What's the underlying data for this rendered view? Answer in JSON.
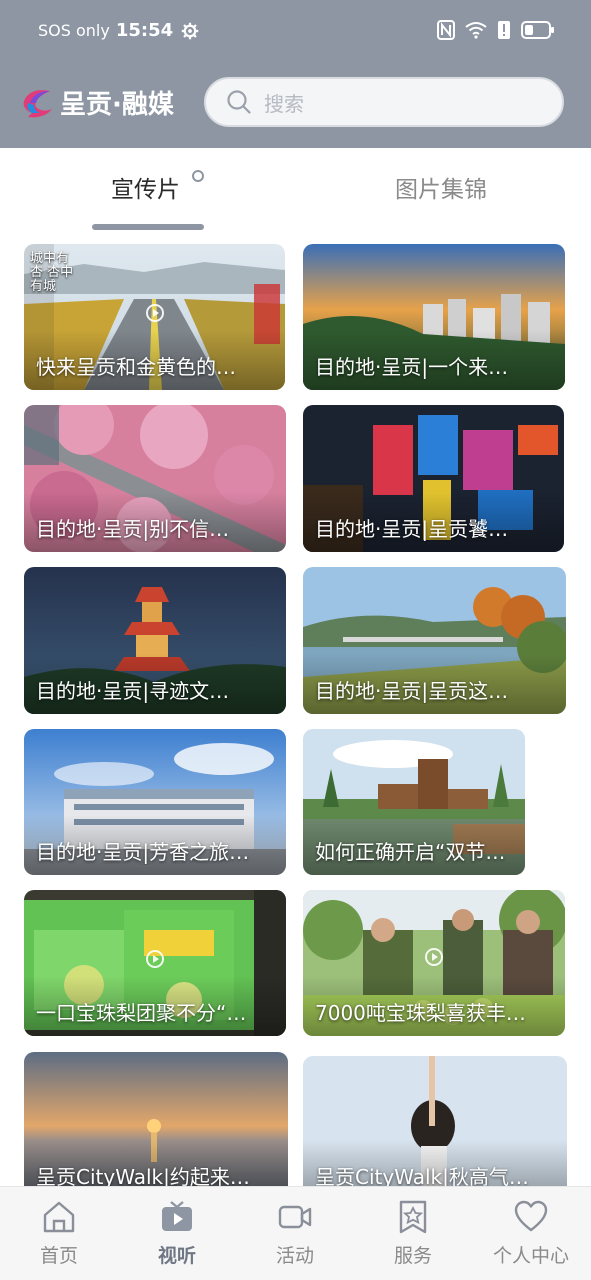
{
  "status_bar": {
    "carrier": "SOS only",
    "time": "15:54"
  },
  "header": {
    "logo_text": "呈贡·融媒",
    "search_placeholder": "搜索"
  },
  "tabs": [
    {
      "label": "宣传片",
      "active": true
    },
    {
      "label": "图片集锦",
      "active": false
    }
  ],
  "cards": [
    {
      "caption": "快来呈贡和金黄色的…",
      "overlay_text": "城中有杏 杏中有城"
    },
    {
      "caption": "目的地·呈贡|一个来…"
    },
    {
      "caption": "目的地·呈贡|别不信…"
    },
    {
      "caption": "目的地·呈贡|呈贡饕…"
    },
    {
      "caption": "目的地·呈贡|寻迹文…"
    },
    {
      "caption": "目的地·呈贡|呈贡这…"
    },
    {
      "caption": "目的地·呈贡|芳香之旅…"
    },
    {
      "caption": "如何正确开启“双节”…"
    },
    {
      "caption": "一口宝珠梨团聚不分“…"
    },
    {
      "caption": "7000吨宝珠梨喜获丰…"
    },
    {
      "caption": "呈贡CityWalk|约起来…"
    },
    {
      "caption": "呈贡CityWalk|秋高气…"
    }
  ],
  "bottom_nav": [
    {
      "label": "首页",
      "icon": "home-icon"
    },
    {
      "label": "视听",
      "icon": "video-play-icon",
      "active": true
    },
    {
      "label": "活动",
      "icon": "camera-icon"
    },
    {
      "label": "服务",
      "icon": "star-bookmark-icon"
    },
    {
      "label": "个人中心",
      "icon": "heart-icon"
    }
  ],
  "colors": {
    "header_bg": "#8e96a3",
    "active_tab_underline": "#8e96a3"
  }
}
